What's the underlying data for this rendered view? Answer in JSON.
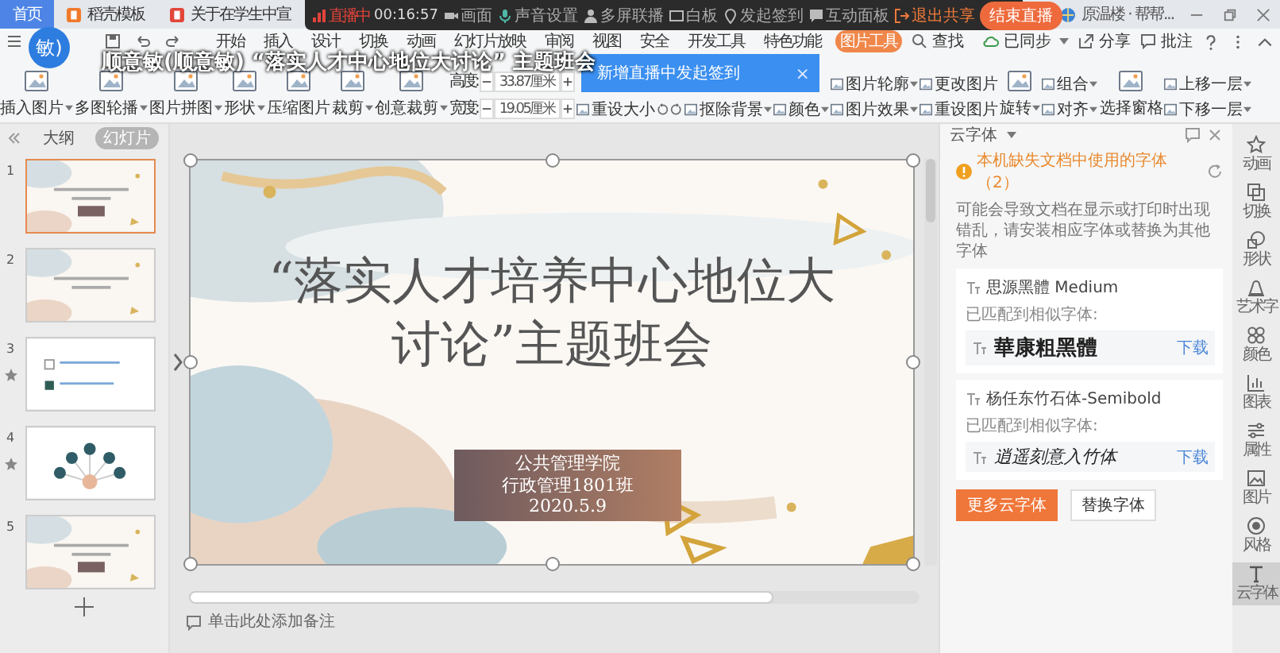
{
  "tabs": [
    {
      "label": "首页",
      "selected": true
    },
    {
      "label": "稻壳模板",
      "selected": false
    },
    {
      "label": "关于在学生中宣",
      "selected": false
    }
  ],
  "account": {
    "name": "原温楼 · 帮帮..."
  },
  "live_bar": {
    "status": "直播中",
    "timer": "00:16:57",
    "items": [
      "画面",
      "声音设置",
      "多屏联播",
      "白板",
      "发起签到",
      "互动面板"
    ],
    "exit": "退出共享",
    "end": "结束直播"
  },
  "caption": {
    "avatar": "敏)",
    "text": "顺意敏(顺意敏) “落实人才中心地位大讨论” 主题班会"
  },
  "menu": [
    {
      "label": "开始",
      "selected": false
    },
    {
      "label": "插入",
      "selected": false
    },
    {
      "label": "设计",
      "selected": false
    },
    {
      "label": "切换",
      "selected": false
    },
    {
      "label": "动画",
      "selected": false
    },
    {
      "label": "幻灯片放映",
      "selected": false
    },
    {
      "label": "审阅",
      "selected": false
    },
    {
      "label": "视图",
      "selected": false
    },
    {
      "label": "安全",
      "selected": false
    },
    {
      "label": "开发工具",
      "selected": false
    },
    {
      "label": "特色功能",
      "selected": false
    },
    {
      "label": "图片工具",
      "selected": true
    }
  ],
  "search": {
    "label": "查找"
  },
  "menu_right": [
    {
      "label": "已同步",
      "dropdown": true
    },
    {
      "label": "分享",
      "dropdown": false
    },
    {
      "label": "批注",
      "dropdown": false
    }
  ],
  "toolbar": [
    {
      "kind": "large",
      "label": "插入图片",
      "dropdown": true
    },
    {
      "kind": "large",
      "label": "多图轮播",
      "dropdown": true
    },
    {
      "kind": "large",
      "label": "图片拼图",
      "dropdown": true
    },
    {
      "kind": "large",
      "label": "形状",
      "dropdown": true
    },
    {
      "kind": "large",
      "label": "压缩图片",
      "dropdown": false
    },
    {
      "kind": "large",
      "label": "裁剪",
      "dropdown": true
    },
    {
      "kind": "large",
      "label": "创意裁剪",
      "dropdown": true
    },
    {
      "kind": "size",
      "fields": [
        {
          "label": "高度:",
          "value": "33.87厘米"
        },
        {
          "label": "宽度:",
          "value": "19.05厘米"
        }
      ]
    },
    {
      "kind": "stack",
      "items": [
        {
          "label": "重设大小",
          "dropdown": false
        }
      ]
    },
    {
      "kind": "rotate"
    },
    {
      "kind": "stack",
      "items": [
        {
          "label": "抠除背景",
          "dropdown": true
        }
      ]
    },
    {
      "kind": "stack",
      "items": [
        {
          "label": "颜色",
          "dropdown": true
        }
      ]
    },
    {
      "kind": "stack",
      "items": [
        {
          "label": "图片轮廓",
          "dropdown": true
        },
        {
          "label": "图片效果",
          "dropdown": true
        }
      ]
    },
    {
      "kind": "stack",
      "items": [
        {
          "label": "更改图片",
          "dropdown": false
        },
        {
          "label": "重设图片",
          "dropdown": false
        }
      ]
    },
    {
      "kind": "large",
      "label": "旋转",
      "dropdown": true
    },
    {
      "kind": "stack",
      "items": [
        {
          "label": "组合",
          "dropdown": true
        },
        {
          "label": "对齐",
          "dropdown": true
        }
      ]
    },
    {
      "kind": "large",
      "label": "选择窗格",
      "dropdown": false
    },
    {
      "kind": "stack",
      "items": [
        {
          "label": "上移一层",
          "dropdown": true
        },
        {
          "label": "下移一层",
          "dropdown": true
        }
      ]
    }
  ],
  "toast": {
    "text": "新增直播中发起签到",
    "close": "×"
  },
  "sidebar": {
    "tabs": [
      {
        "label": "大纲",
        "selected": false
      },
      {
        "label": "幻灯片",
        "selected": true
      }
    ],
    "slides": [
      {
        "number": "1",
        "selected": true,
        "animated": false
      },
      {
        "number": "2",
        "selected": false,
        "animated": false
      },
      {
        "number": "3",
        "selected": false,
        "animated": true
      },
      {
        "number": "4",
        "selected": false,
        "animated": true
      },
      {
        "number": "5",
        "selected": false,
        "animated": false
      }
    ]
  },
  "slide": {
    "title_lines": [
      "“落实人才培养中心地位大",
      "讨论”主题班会"
    ],
    "info_lines": [
      "公共管理学院",
      "行政管理1801班",
      "2020.5.9"
    ]
  },
  "notes": {
    "placeholder": "单击此处添加备注"
  },
  "font_panel": {
    "title": "云字体",
    "warning": "本机缺失文档中使用的字体（2）",
    "description": "可能会导致文档在显示或打印时出现错乱，请安装相应字体或替换为其他字体",
    "fonts": [
      {
        "name": "思源黑體 Medium",
        "match_label": "已匹配到相似字体:",
        "match": "華康粗黑體",
        "kind": "heavy",
        "action": "下载"
      },
      {
        "name": "杨任东竹石体-Semibold",
        "match_label": "已匹配到相似字体:",
        "match": "逍遥刻意入竹体",
        "kind": "brush",
        "action": "下载"
      }
    ],
    "buttons": [
      {
        "label": "更多云字体",
        "primary": true
      },
      {
        "label": "替换字体",
        "primary": false
      }
    ]
  },
  "right_bar": [
    {
      "label": "动画",
      "selected": false
    },
    {
      "label": "切换",
      "selected": false
    },
    {
      "label": "形状",
      "selected": false
    },
    {
      "label": "艺术字",
      "selected": false
    },
    {
      "label": "颜色",
      "selected": false
    },
    {
      "label": "图表",
      "selected": false
    },
    {
      "label": "属性",
      "selected": false
    },
    {
      "label": "图片",
      "selected": false
    },
    {
      "label": "风格",
      "selected": false
    },
    {
      "label": "云字体",
      "selected": true
    }
  ]
}
